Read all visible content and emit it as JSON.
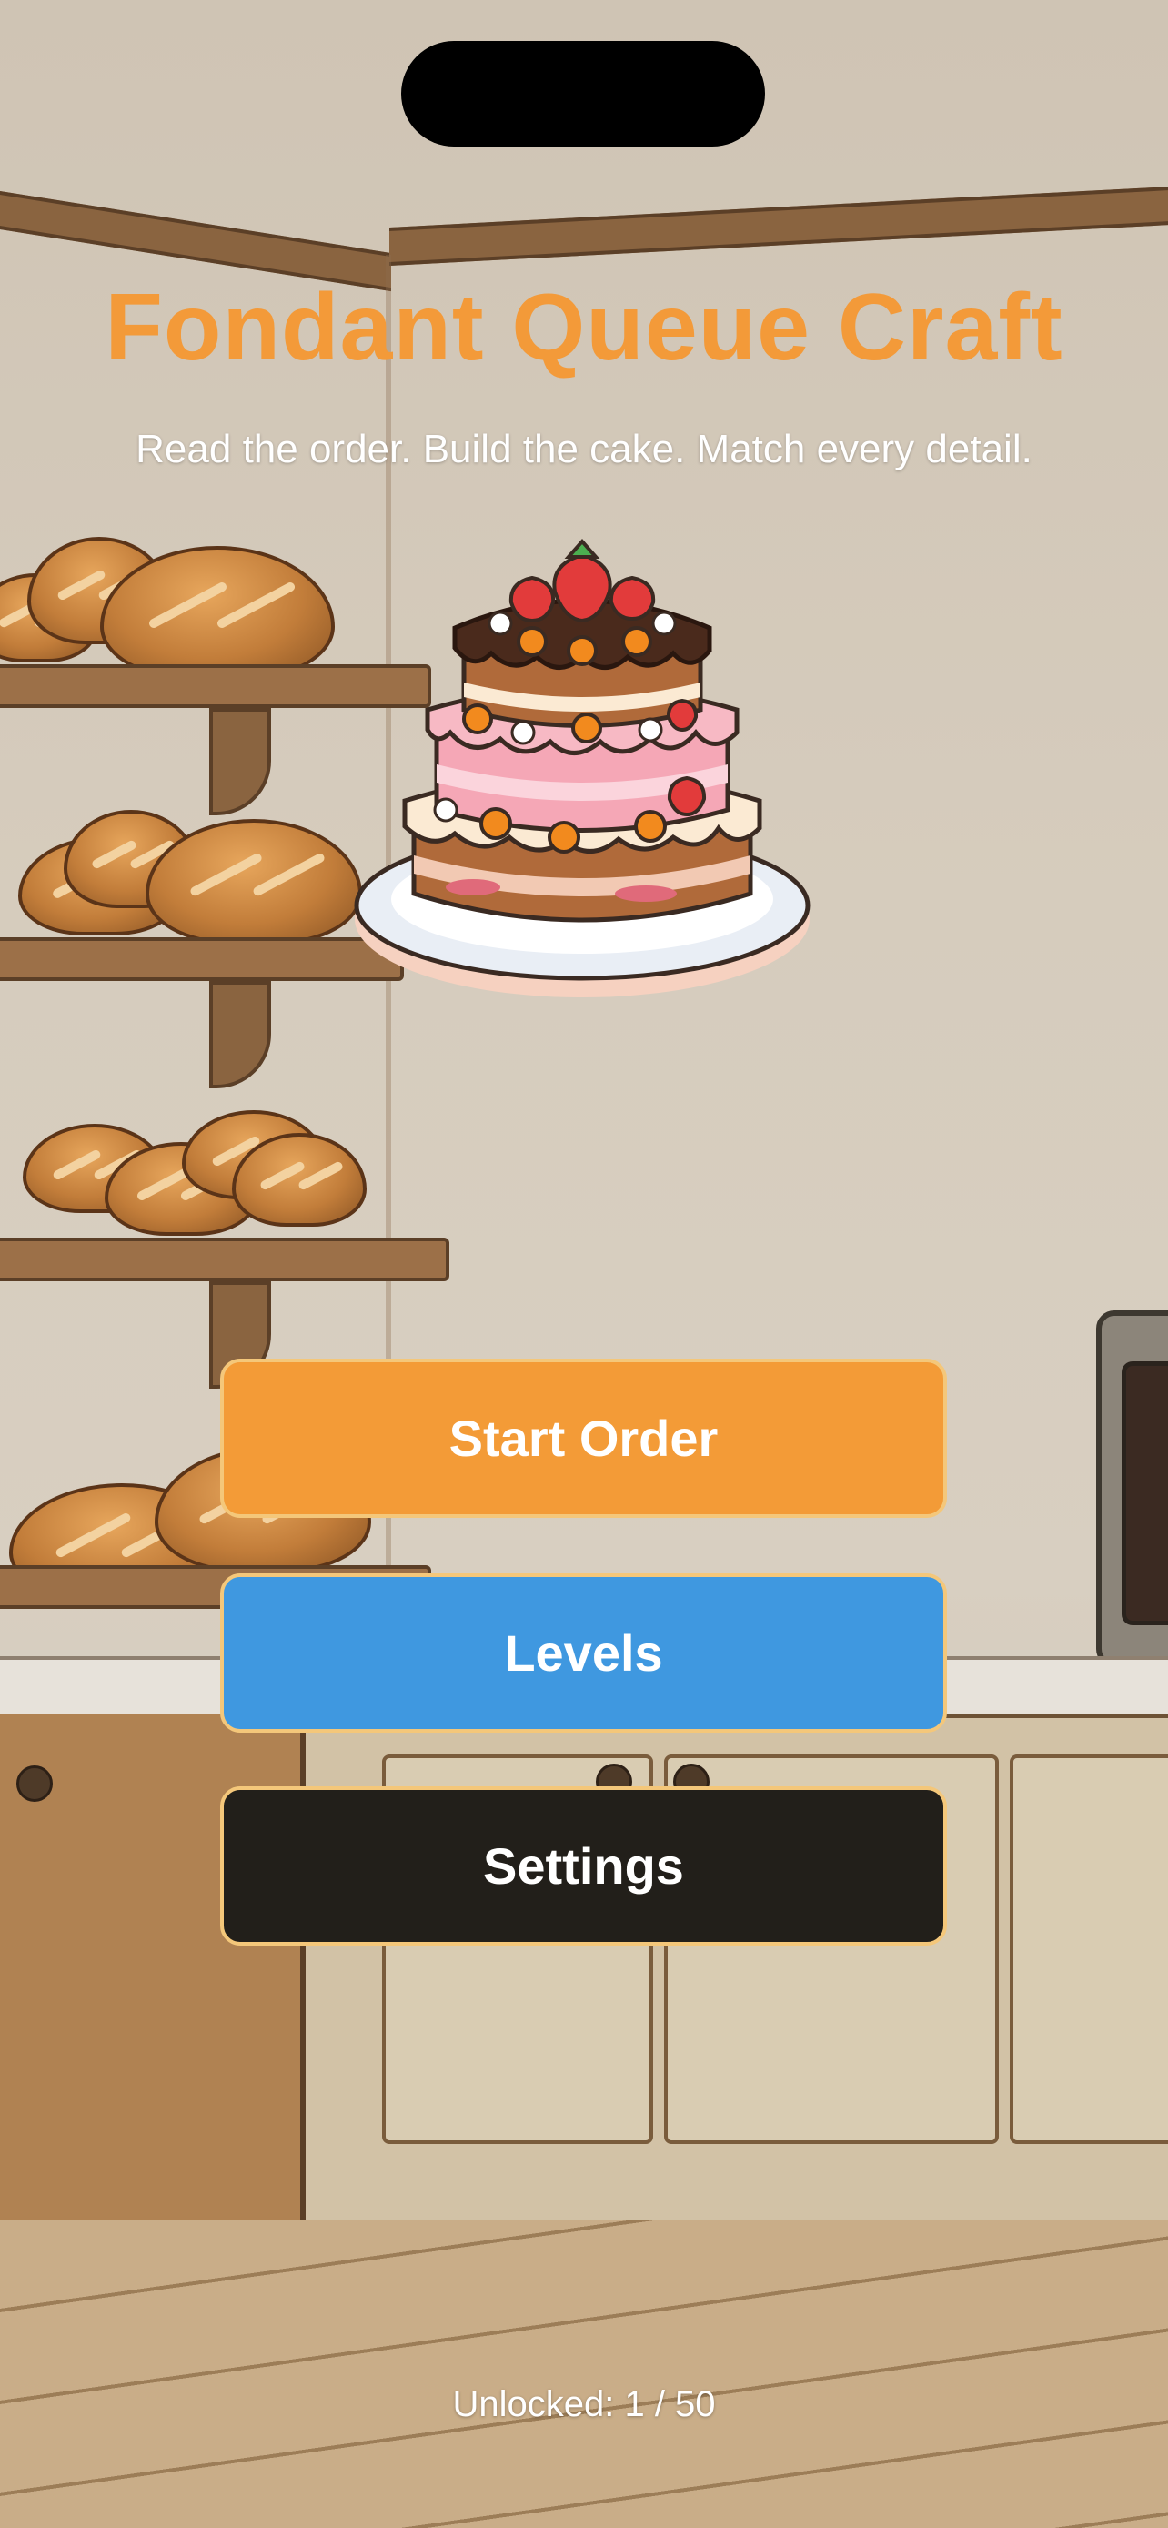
{
  "app": {
    "title": "Fondant Queue Craft",
    "subtitle": "Read the order. Build the cake. Match every detail."
  },
  "menu": {
    "start_label": "Start Order",
    "levels_label": "Levels",
    "settings_label": "Settings"
  },
  "progress": {
    "unlocked_text": "Unlocked: 1 / 50",
    "unlocked": 1,
    "total": 50
  },
  "icons": {
    "hero": "layered-cake-icon"
  },
  "colors": {
    "title": "#f39a39",
    "start_button": "#f39b37",
    "levels_button": "#3f98e0",
    "settings_button": "#221f1a",
    "button_border": "#f4c77a"
  }
}
